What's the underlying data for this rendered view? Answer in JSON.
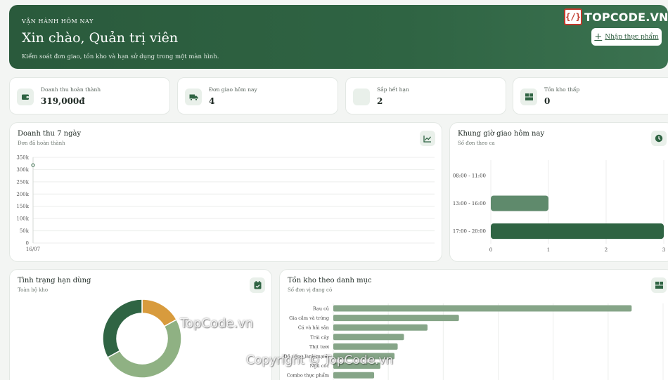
{
  "hero": {
    "eyebrow": "VẬN HÀNH HÔM NAY",
    "title": "Xin chào, Quản trị viên",
    "subtitle": "Kiểm soát đơn giao, tồn kho và hạn sử dụng trong một màn hình.",
    "import_button": "Nhập thực phẩm"
  },
  "logo": {
    "mark": "{/}",
    "text": "TOPCODE.VN"
  },
  "stats": [
    {
      "label": "Doanh thu hoàn thành",
      "value": "319,000đ",
      "icon": "wallet-icon"
    },
    {
      "label": "Đơn giao hôm nay",
      "value": "4",
      "icon": "truck-icon"
    },
    {
      "label": "Sắp hết hạn",
      "value": "2",
      "icon": "hourglass-icon"
    },
    {
      "label": "Tồn kho thấp",
      "value": "0",
      "icon": "boxes-icon"
    }
  ],
  "revenue": {
    "title": "Doanh thu 7 ngày",
    "subtitle": "Đơn đã hoàn thành",
    "icon": "line-chart-icon"
  },
  "slots": {
    "title": "Khung giờ giao hôm nay",
    "subtitle": "Số đơn theo ca",
    "icon": "clock-icon"
  },
  "expiry": {
    "title": "Tình trạng hạn dùng",
    "subtitle": "Toàn bộ kho",
    "icon": "calendar-check-icon"
  },
  "stock": {
    "title": "Tồn kho theo danh mục",
    "subtitle": "Số đơn vị đang có",
    "icon": "boxes-icon"
  },
  "watermarks": {
    "center": "TopCode.vn",
    "copyright": "Copyright © TopCode.vn"
  },
  "colors": {
    "primary": "#2f6443",
    "mid": "#5f8a6c",
    "light": "#8fb183",
    "amber": "#d89b3d"
  },
  "chart_data": [
    {
      "type": "line",
      "x": [
        "16/07"
      ],
      "series": [
        {
          "values": [
            318000
          ]
        }
      ],
      "ylim": [
        0,
        350000
      ],
      "yticks": [
        "0",
        "50k",
        "100k",
        "150k",
        "200k",
        "250k",
        "300k",
        "350k"
      ],
      "grid": true
    },
    {
      "type": "bar",
      "orientation": "horizontal",
      "categories": [
        "08:00 - 11:00",
        "13:00 - 16:00",
        "17:00 - 20:00"
      ],
      "values": [
        0,
        1,
        3
      ],
      "xlim": [
        0,
        3
      ],
      "xticks": [
        "0",
        "1",
        "2",
        "3"
      ]
    },
    {
      "type": "pie",
      "variant": "donut",
      "values": [
        0.17,
        0.5,
        0.33
      ],
      "colors": [
        "#d89b3d",
        "#8fb183",
        "#2f6443"
      ]
    },
    {
      "type": "bar",
      "orientation": "horizontal",
      "categories": [
        "Rau củ",
        "Gia cầm và trứng",
        "Cá và hải sản",
        "Trái cây",
        "Thịt tươi",
        "Đồ uống lành mạnh",
        "Ngũ cốc",
        "Combo thực phẩm"
      ],
      "values": [
        38,
        16,
        12,
        9,
        8.2,
        7.8,
        6,
        5.2
      ],
      "xlim": [
        0,
        42
      ]
    }
  ]
}
